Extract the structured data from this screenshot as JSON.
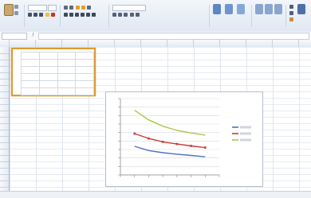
{
  "app": {
    "accent": "#2a5b9e",
    "selection_color": "#e09a2d"
  },
  "ribbon": {
    "groups": [
      "clipboard-group",
      "font-group",
      "alignment-group",
      "number-group",
      "styles-group",
      "cells-group",
      "editing-group"
    ]
  },
  "spreadsheet": {
    "grid_line_color": "#dfe5ee",
    "header_color": "#e4eaf2"
  },
  "chart": {
    "series_colors": [
      "#4a73c4",
      "#c83a3a",
      "#a8c84a"
    ]
  }
}
